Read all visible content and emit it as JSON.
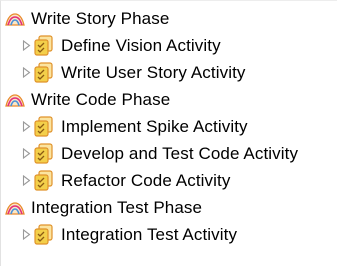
{
  "tree": {
    "phases": [
      {
        "label": "Write Story Phase",
        "icon": "phase-icon",
        "activities": [
          {
            "label": "Define Vision Activity",
            "icon": "activity-icon"
          },
          {
            "label": "Write User Story Activity",
            "icon": "activity-icon"
          }
        ]
      },
      {
        "label": "Write Code Phase",
        "icon": "phase-icon",
        "activities": [
          {
            "label": "Implement Spike Activity",
            "icon": "activity-icon"
          },
          {
            "label": "Develop and Test Code Activity",
            "icon": "activity-icon"
          },
          {
            "label": "Refactor Code Activity",
            "icon": "activity-icon"
          }
        ]
      },
      {
        "label": "Integration Test Phase",
        "icon": "phase-icon",
        "activities": [
          {
            "label": "Integration Test Activity",
            "icon": "activity-icon"
          }
        ]
      }
    ]
  },
  "colors": {
    "twisty": "#9a9a9a",
    "phase_icon_orange": "#e9892c",
    "phase_icon_pink": "#e3307a",
    "phase_icon_blue": "#4a90d9",
    "activity_icon_yellow": "#f3cf4a",
    "activity_icon_orange": "#e0922b"
  }
}
